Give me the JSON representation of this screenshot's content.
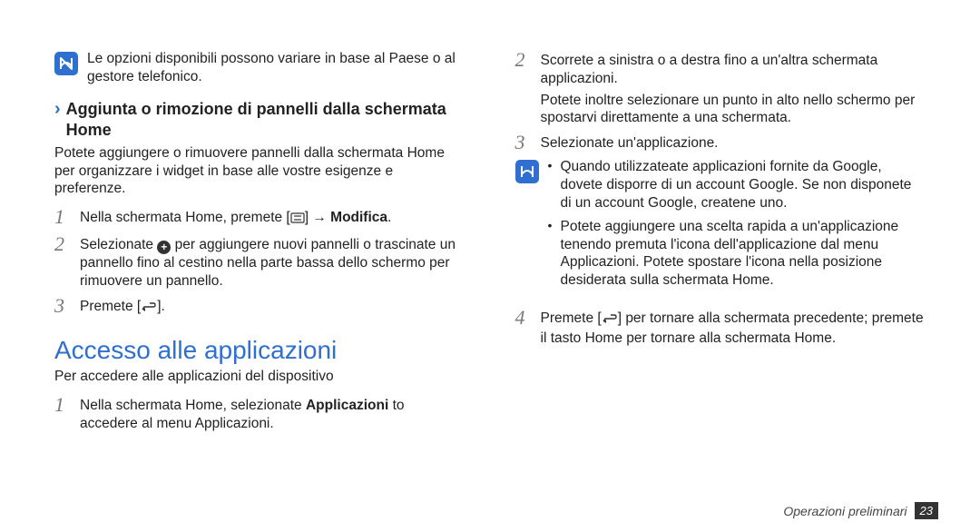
{
  "left": {
    "note": "Le opzioni disponibili possono variare in base al Paese o al gestore telefonico.",
    "section_title": "Aggiunta o rimozione di pannelli dalla schermata Home",
    "section_intro": "Potete aggiungere o rimuovere pannelli dalla schermata Home per organizzare i widget in base alle vostre esigenze e preferenze.",
    "step1_pre": "Nella schermata Home, premete [",
    "step1_post": "] → ",
    "step1_bold": "Modifica",
    "step1_end": ".",
    "step2_pre": "Selezionate ",
    "step2_post": " per aggiungere nuovi pannelli o trascinate un pannello fino al cestino nella parte bassa dello schermo per rimuovere un pannello.",
    "step3_pre": "Premete [",
    "step3_post": "].",
    "title2": "Accesso alle applicazioni",
    "title2_sub": "Per accedere alle applicazioni del dispositivo",
    "app_step1_pre": "Nella schermata Home, selezionate ",
    "app_step1_bold": "Applicazioni",
    "app_step1_post": " to accedere al menu Applicazioni."
  },
  "right": {
    "step2": "Scorrete a sinistra o a destra fino a un'altra schermata applicazioni.",
    "step2_extra": "Potete inoltre selezionare un punto in alto nello schermo per spostarvi direttamente a una schermata.",
    "step3": "Selezionate un'applicazione.",
    "note_bullet1": "Quando utilizzateate applicazioni fornite da Google, dovete disporre di un account Google. Se non disponete di un account Google, createne uno.",
    "note_bullet2": "Potete aggiungere una scelta rapida a un'applicazione tenendo premuta l'icona dell'applicazione dal menu Applicazioni. Potete spostare l'icona nella posizione desiderata sulla schermata Home.",
    "step4_pre": "Premete [",
    "step4_post": "] per tornare alla schermata precedente; premete il tasto Home per tornare alla schermata Home."
  },
  "footer": {
    "label": "Operazioni preliminari",
    "page": "23"
  }
}
